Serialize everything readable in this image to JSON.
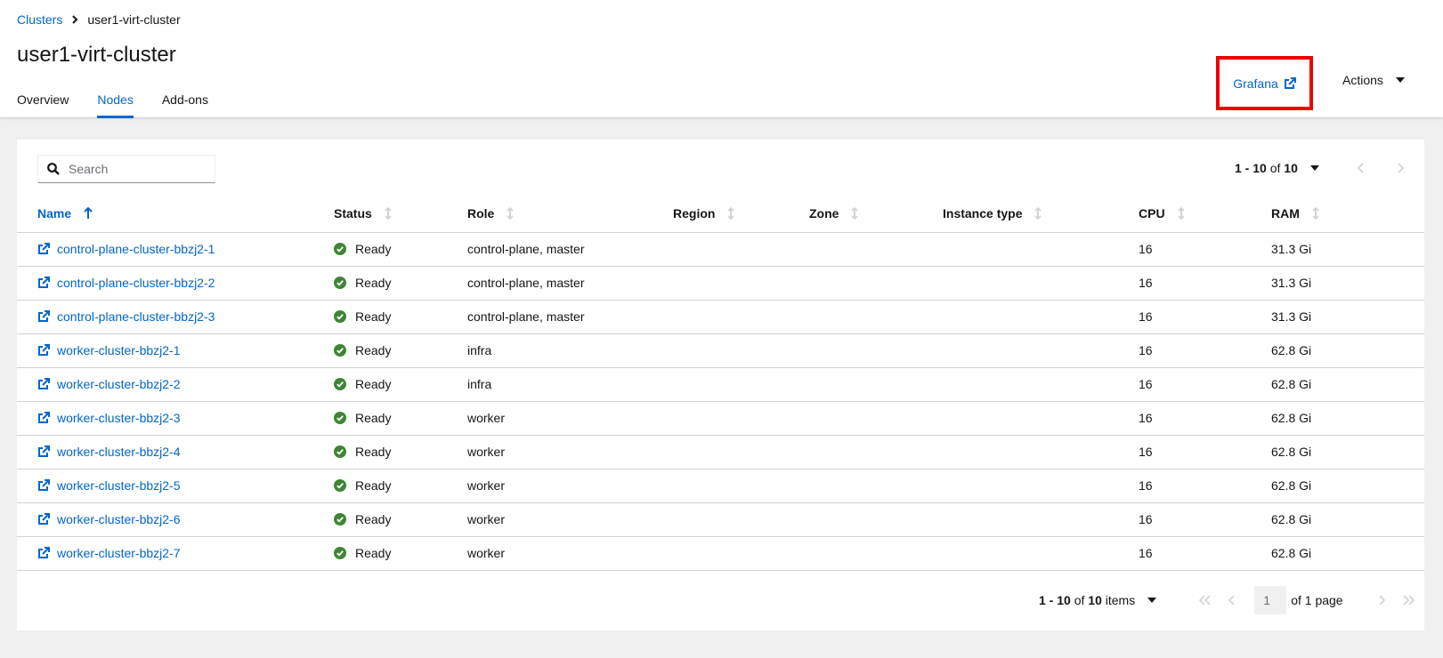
{
  "breadcrumb": {
    "root": "Clusters",
    "current": "user1-virt-cluster"
  },
  "page": {
    "title": "user1-virt-cluster"
  },
  "tabs": [
    {
      "label": "Overview",
      "active": false
    },
    {
      "label": "Nodes",
      "active": true
    },
    {
      "label": "Add-ons",
      "active": false
    }
  ],
  "header_actions": {
    "grafana_label": "Grafana",
    "actions_label": "Actions"
  },
  "toolbar": {
    "search_placeholder": "Search",
    "pagination": {
      "range": "1 - 10",
      "of_word": "of",
      "total": "10"
    }
  },
  "table": {
    "columns": [
      "Name",
      "Status",
      "Role",
      "Region",
      "Zone",
      "Instance type",
      "CPU",
      "RAM"
    ],
    "rows": [
      {
        "name": "control-plane-cluster-bbzj2-1",
        "status": "Ready",
        "role": "control-plane, master",
        "region": "",
        "zone": "",
        "instance_type": "",
        "cpu": "16",
        "ram": "31.3 Gi"
      },
      {
        "name": "control-plane-cluster-bbzj2-2",
        "status": "Ready",
        "role": "control-plane, master",
        "region": "",
        "zone": "",
        "instance_type": "",
        "cpu": "16",
        "ram": "31.3 Gi"
      },
      {
        "name": "control-plane-cluster-bbzj2-3",
        "status": "Ready",
        "role": "control-plane, master",
        "region": "",
        "zone": "",
        "instance_type": "",
        "cpu": "16",
        "ram": "31.3 Gi"
      },
      {
        "name": "worker-cluster-bbzj2-1",
        "status": "Ready",
        "role": "infra",
        "region": "",
        "zone": "",
        "instance_type": "",
        "cpu": "16",
        "ram": "62.8 Gi"
      },
      {
        "name": "worker-cluster-bbzj2-2",
        "status": "Ready",
        "role": "infra",
        "region": "",
        "zone": "",
        "instance_type": "",
        "cpu": "16",
        "ram": "62.8 Gi"
      },
      {
        "name": "worker-cluster-bbzj2-3",
        "status": "Ready",
        "role": "worker",
        "region": "",
        "zone": "",
        "instance_type": "",
        "cpu": "16",
        "ram": "62.8 Gi"
      },
      {
        "name": "worker-cluster-bbzj2-4",
        "status": "Ready",
        "role": "worker",
        "region": "",
        "zone": "",
        "instance_type": "",
        "cpu": "16",
        "ram": "62.8 Gi"
      },
      {
        "name": "worker-cluster-bbzj2-5",
        "status": "Ready",
        "role": "worker",
        "region": "",
        "zone": "",
        "instance_type": "",
        "cpu": "16",
        "ram": "62.8 Gi"
      },
      {
        "name": "worker-cluster-bbzj2-6",
        "status": "Ready",
        "role": "worker",
        "region": "",
        "zone": "",
        "instance_type": "",
        "cpu": "16",
        "ram": "62.8 Gi"
      },
      {
        "name": "worker-cluster-bbzj2-7",
        "status": "Ready",
        "role": "worker",
        "region": "",
        "zone": "",
        "instance_type": "",
        "cpu": "16",
        "ram": "62.8 Gi"
      }
    ]
  },
  "bottom_pagination": {
    "range": "1 - 10",
    "of_word": "of",
    "total": "10",
    "items_word": "items",
    "page_value": "1",
    "of_page_text": "of 1 page"
  },
  "colors": {
    "link": "#0066cc",
    "status_ok": "#3e8635",
    "highlight": "#ee0000"
  }
}
